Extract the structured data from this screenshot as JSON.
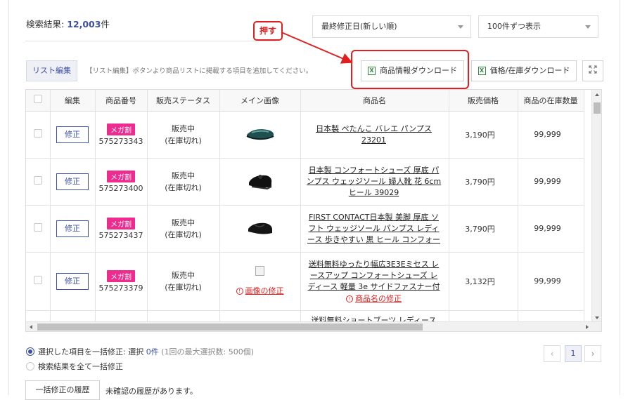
{
  "header": {
    "result_label": "検索結果:",
    "result_count": "12,003",
    "result_unit": "件",
    "sort_select": "最終修正日(新しい順)",
    "per_page_select": "100件ずつ表示"
  },
  "annotation": {
    "label": "押す"
  },
  "toolbar": {
    "list_edit": "リスト編集",
    "hint": "【リスト編集】ボタンより商品リストに掲載する項目を追加してください。",
    "download_product": "商品情報ダウンロード",
    "download_price": "価格/在庫ダウンロード",
    "excel_glyph": "X"
  },
  "table": {
    "headers": [
      "編集",
      "商品番号",
      "販売ステータス",
      "メイン画像",
      "商品名",
      "販売価格",
      "商品の在庫数量"
    ],
    "edit_label": "修正",
    "badge": "メガ割",
    "rows": [
      {
        "id": "575273343",
        "status1": "販売中",
        "status2": "(在庫切れ)",
        "name": "日本製 ぺたんこ バレエ パンプス 23201",
        "price": "3,190円",
        "stock": "99,999"
      },
      {
        "id": "575273400",
        "status1": "販売中",
        "status2": "(在庫切れ)",
        "name": "日本製 コンフォートシューズ 厚底 パンプス ウェッジソール 婦人靴 花 6cmヒール 39029",
        "price": "3,790円",
        "stock": "99,999"
      },
      {
        "id": "575273437",
        "status1": "販売中",
        "status2": "(在庫切れ)",
        "name": "FIRST CONTACT日本製 美脚 厚底 ソフト ウェッジソール パンプス レディース 歩きやすい 黒 ヒール コンフォートシュ…",
        "price": "3,790円",
        "stock": "99,999"
      },
      {
        "id": "575273379",
        "status1": "販売中",
        "status2": "(在庫切れ)",
        "name": "送料無料ゆったり幅広3E3Eミセス レースアップ コンフォートシューズ レディース 軽量 3e サイドファスナー付 スニーカー …",
        "price": "3,132円",
        "stock": "99,999",
        "image_error": "画像の修正",
        "name_error": "商品名の修正"
      },
      {
        "name": "送料無料ショートブーツ レディース ヒー"
      }
    ]
  },
  "footer": {
    "radio_selected_label": "選択した項目を一括修正: 選択",
    "radio_selected_count": "0件",
    "radio_selected_note": "(1回の最大選択数: 500個)",
    "radio_all_label": "検索結果を全て一括修正",
    "page": "1",
    "history_button": "一括修正の履歴",
    "history_note": "未確認の履歴があります。"
  },
  "colors": {
    "accent": "#3d4fa0",
    "badge": "#ec2c8f",
    "annotation": "#e02020",
    "excel": "#2e8b3e"
  }
}
